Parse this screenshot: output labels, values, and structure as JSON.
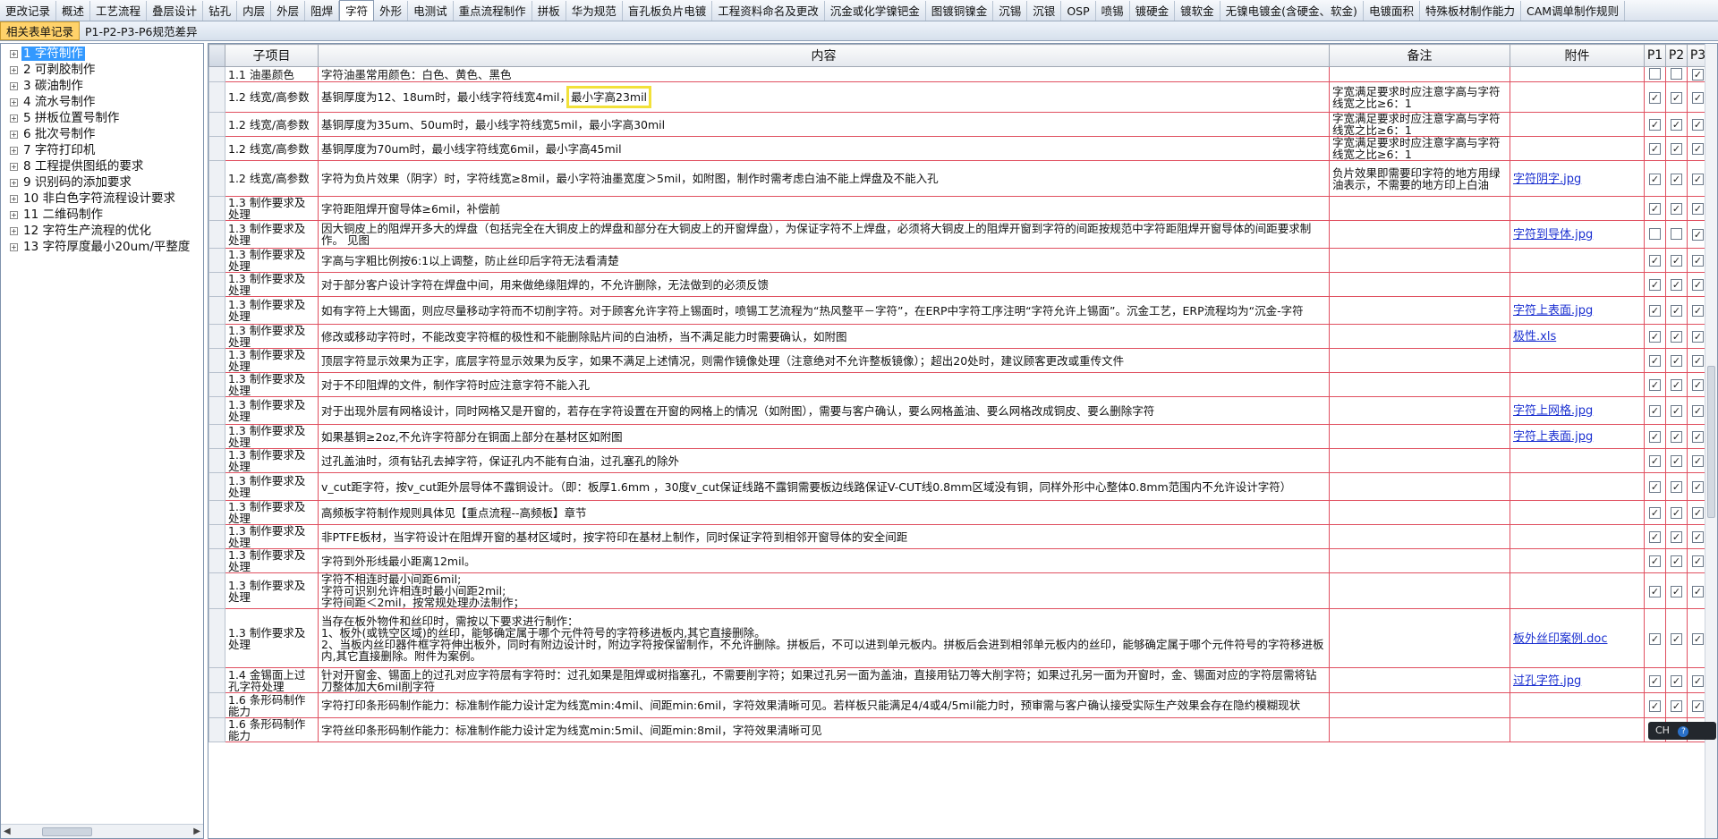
{
  "top_tabs": [
    "更改记录",
    "概述",
    "工艺流程",
    "叠层设计",
    "钻孔",
    "内层",
    "外层",
    "阻焊",
    "字符",
    "外形",
    "电测试",
    "重点流程制作",
    "拼板",
    "华为规范",
    "盲孔板负片电镀",
    "工程资料命名及更改",
    "沉金或化学镍钯金",
    "图镀铜镍金",
    "沉锡",
    "沉银",
    "OSP",
    "喷锡",
    "镀硬金",
    "镀软金",
    "无镍电镀金(含硬金、软金)",
    "电镀面积",
    "特殊板材制作能力",
    "CAM调单制作规则"
  ],
  "active_top_tab": "字符",
  "sub_tabs": [
    "相关表单记录",
    "P1-P2-P3-P6规范差异"
  ],
  "active_sub_tab": "相关表单记录",
  "tree": [
    {
      "label": "1 字符制作",
      "selected": true
    },
    {
      "label": "2 可剥胶制作"
    },
    {
      "label": "3 碳油制作"
    },
    {
      "label": "4 流水号制作"
    },
    {
      "label": "5 拼板位置号制作"
    },
    {
      "label": "6 批次号制作"
    },
    {
      "label": "7 字符打印机"
    },
    {
      "label": "8 工程提供图纸的要求"
    },
    {
      "label": "9 识别码的添加要求"
    },
    {
      "label": "10 非白色字符流程设计要求"
    },
    {
      "label": "11 二维码制作"
    },
    {
      "label": "12 字符生产流程的优化"
    },
    {
      "label": "13 字符厚度最小20um/平整度"
    }
  ],
  "tree_expander": "+",
  "grid": {
    "headers": {
      "item": "子项目",
      "content": "内容",
      "remark": "备注",
      "attachment": "附件",
      "p1": "P1",
      "p2": "P2",
      "p3": "P3"
    },
    "rows": [
      {
        "item": "1.1 油墨颜色",
        "content": "字符油墨常用颜色：白色、黄色、黑色",
        "remark": "",
        "attachment": "",
        "p": [
          false,
          false,
          true
        ]
      },
      {
        "item": "1.2 线宽/高参数",
        "content_a": "基铜厚度为12、18um时，最小线字符线宽4mil，",
        "content_b": "最小字高23mil",
        "remark": "字宽满足要求时应注意字高与字符线宽之比≥6：1",
        "attachment": "",
        "p": [
          true,
          true,
          true
        ]
      },
      {
        "item": "1.2 线宽/高参数",
        "content": "基铜厚度为35um、50um时，最小线字符线宽5mil，最小字高30mil",
        "remark": "字宽满足要求时应注意字高与字符线宽之比≥6：1",
        "attachment": "",
        "p": [
          true,
          true,
          true
        ]
      },
      {
        "item": "1.2 线宽/高参数",
        "content": "基铜厚度为70um时，最小线字符线宽6mil，最小字高45mil",
        "remark": "字宽满足要求时应注意字高与字符线宽之比≥6：1",
        "attachment": "",
        "p": [
          true,
          true,
          true
        ]
      },
      {
        "item": "1.2 线宽/高参数",
        "content": "字符为负片效果（阴字）时，字符线宽≥8mil，最小字符油墨宽度＞5mil，如附图，制作时需考虑白油不能上焊盘及不能入孔",
        "remark": "负片效果即需要印字符的地方用绿油表示，不需要的地方印上白油",
        "attachment": "字符阴字.jpg",
        "p": [
          true,
          true,
          true
        ]
      },
      {
        "item": "1.3 制作要求及处理",
        "content": "字符距阻焊开窗导体≥6mil，补偿前",
        "remark": "",
        "attachment": "",
        "p": [
          true,
          true,
          true
        ]
      },
      {
        "item": "1.3 制作要求及处理",
        "content": "因大铜皮上的阻焊开多大的焊盘（包括完全在大铜皮上的焊盘和部分在大铜皮上的开窗焊盘），为保证字符不上焊盘，必须将大铜皮上的阻焊开窗到字符的间距按规范中字符距阻焊开窗导体的间距要求制作。 见图",
        "remark": "",
        "attachment": "字符到导体.jpg",
        "p": [
          false,
          false,
          true
        ]
      },
      {
        "item": "1.3 制作要求及处理",
        "content": "字高与字粗比例按6:1以上调整，防止丝印后字符无法看清楚",
        "remark": "",
        "attachment": "",
        "p": [
          true,
          true,
          true
        ]
      },
      {
        "item": "1.3 制作要求及处理",
        "content": "对于部分客户设计字符在焊盘中间，用来做绝缘阻焊的，不允许删除，无法做到的必须反馈",
        "remark": "",
        "attachment": "",
        "p": [
          true,
          true,
          true
        ]
      },
      {
        "item": "1.3 制作要求及处理",
        "content": "如有字符上大锡面，则应尽量移动字符而不切削字符。对于顾客允许字符上锡面时，喷锡工艺流程为“热风整平－字符”，在ERP中字符工序注明“字符允许上锡面”。沉金工艺，ERP流程均为“沉金-字符",
        "remark": "",
        "attachment": "字符上表面.jpg",
        "p": [
          true,
          true,
          true
        ]
      },
      {
        "item": "1.3 制作要求及处理",
        "content": "修改或移动字符时，不能改变字符框的极性和不能删除贴片间的白油桥，当不满足能力时需要确认，如附图",
        "remark": "",
        "attachment": "极性.xls",
        "p": [
          true,
          true,
          true
        ]
      },
      {
        "item": "1.3 制作要求及处理",
        "content": "顶层字符显示效果为正字，底层字符显示效果为反字，如果不满足上述情况，则需作镜像处理（注意绝对不允许整板镜像）；超出20处时，建议顾客更改或重传文件",
        "remark": "",
        "attachment": "",
        "p": [
          true,
          true,
          true
        ]
      },
      {
        "item": "1.3 制作要求及处理",
        "content": "对于不印阻焊的文件，制作字符时应注意字符不能入孔",
        "remark": "",
        "attachment": "",
        "p": [
          true,
          true,
          true
        ]
      },
      {
        "item": "1.3 制作要求及处理",
        "content": "对于出现外层有网格设计，同时网格又是开窗的，若存在字符设置在开窗的网格上的情况（如附图），需要与客户确认，要么网格盖油、要么网格改成铜皮、要么删除字符",
        "remark": "",
        "attachment": "字符上网格.jpg",
        "p": [
          true,
          true,
          true
        ]
      },
      {
        "item": "1.3 制作要求及处理",
        "content": "如果基铜≥2oz,不允许字符部分在铜面上部分在基材区如附图",
        "remark": "",
        "attachment": "字符上表面.jpg",
        "p": [
          true,
          true,
          true
        ]
      },
      {
        "item": "1.3 制作要求及处理",
        "content": "过孔盖油时，须有钻孔去掉字符，保证孔内不能有白油，过孔塞孔的除外",
        "remark": "",
        "attachment": "",
        "p": [
          true,
          true,
          true
        ]
      },
      {
        "item": "1.3 制作要求及处理",
        "content": "v_cut距字符，按v_cut距外层导体不露铜设计。（即：板厚1.6mm ，30度v_cut保证线路不露铜需要板边线路保证V-CUT线0.8mm区域没有铜，同样外形中心整体0.8mm范围内不允许设计字符）",
        "remark": "",
        "attachment": "",
        "p": [
          true,
          true,
          true
        ]
      },
      {
        "item": "1.3 制作要求及处理",
        "content": "高频板字符制作规则具体见【重点流程--高频板】章节",
        "remark": "",
        "attachment": "",
        "p": [
          true,
          true,
          true
        ]
      },
      {
        "item": "1.3 制作要求及处理",
        "content": "非PTFE板材，当字符设计在阻焊开窗的基材区域时，按字符印在基材上制作，同时保证字符到相邻开窗导体的安全间距",
        "remark": "",
        "attachment": "",
        "p": [
          true,
          true,
          true
        ]
      },
      {
        "item": "1.3 制作要求及处理",
        "content": "字符到外形线最小距离12mil。",
        "remark": "",
        "attachment": "",
        "p": [
          true,
          true,
          true
        ]
      },
      {
        "item": "1.3 制作要求及处理",
        "content": "字符不相连时最小间距6mil;\n字符可识别允许相连时最小间距2mil;\n字符间距＜2mil，按常规处理办法制作；",
        "remark": "",
        "attachment": "",
        "p": [
          true,
          true,
          true
        ]
      },
      {
        "item": "1.3 制作要求及处理",
        "content": "当存在板外物件和丝印时，需按以下要求进行制作：\n1、板外(或铣空区域)的丝印，能够确定属于哪个元件符号的字符移进板内,其它直接删除。\n2、当板内丝印器件框字符伸出板外，同时有附边设计时，附边字符按保留制作，不允许删除。拼板后，不可以进到单元板内。拼板后会进到相邻单元板内的丝印，能够确定属于哪个元件符号的字符移进板内,其它直接删除。附件为案例。",
        "remark": "",
        "attachment": "板外丝印案例.doc",
        "p": [
          true,
          true,
          true
        ]
      },
      {
        "item": "1.4 金锡面上过孔字符处理",
        "content": "针对开窗金、锡面上的过孔对应字符层有字符时：过孔如果是阻焊或树指塞孔，不需要削字符；如果过孔另一面为盖油，直接用钻刀等大削字符；如果过孔另一面为开窗时，金、锡面对应的字符层需将钻刀整体加大6mil削字符",
        "remark": "",
        "attachment": "过孔字符.jpg",
        "p": [
          true,
          true,
          true
        ]
      },
      {
        "item": "1.6 条形码制作能力",
        "content": "字符打印条形码制作能力：标准制作能力设计定为线宽min:4mil、间距min:6mil，字符效果清晰可见。若样板只能满足4/4或4/5mil能力时，预审需与客户确认接受实际生产效果会存在隐约模糊现状",
        "remark": "",
        "attachment": "",
        "p": [
          true,
          true,
          true
        ]
      },
      {
        "item": "1.6 条形码制作能力",
        "content": "字符丝印条形码制作能力：标准制作能力设计定为线宽min:5mil、间距min:8mil，字符效果清晰可见",
        "remark": "",
        "attachment": "",
        "p": [
          true,
          true,
          true
        ]
      }
    ]
  },
  "ime": {
    "label": "CH",
    "help": "?"
  },
  "check_glyph": "✓",
  "colors": {
    "grid_line": "#e05060",
    "selection": "#3399ff",
    "active_subtab": "#ffd26a",
    "link": "#1a2fd0",
    "highlight": "#f2e13a"
  }
}
